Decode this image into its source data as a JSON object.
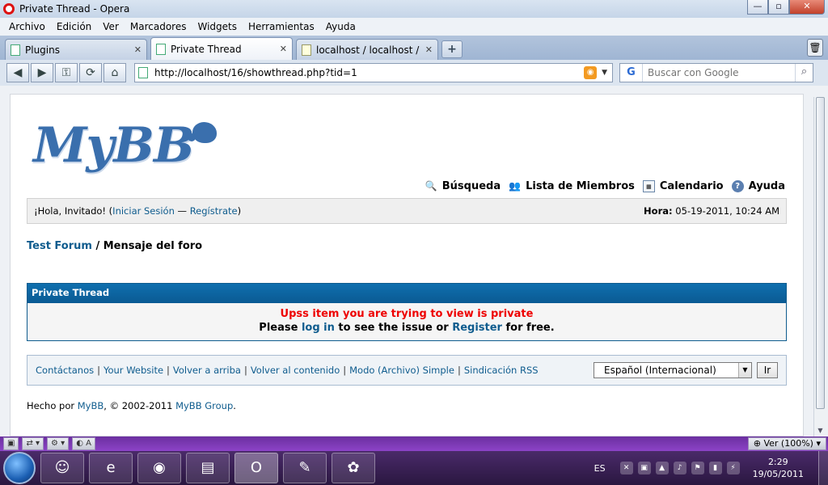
{
  "window": {
    "title": "Private Thread - Opera",
    "minimize": "—",
    "maximize": "▫",
    "close": "✕"
  },
  "menu": [
    "Archivo",
    "Edición",
    "Ver",
    "Marcadores",
    "Widgets",
    "Herramientas",
    "Ayuda"
  ],
  "tabs": [
    {
      "label": "Plugins",
      "close": "✕"
    },
    {
      "label": "Private Thread",
      "close": "✕"
    },
    {
      "label": "localhost / localhost / ...",
      "close": "✕"
    }
  ],
  "new_tab": "+",
  "address": {
    "url": "http://localhost/16/showthread.php?tid=1"
  },
  "search": {
    "placeholder": "Buscar con Google",
    "engine_icon": "G"
  },
  "page": {
    "logo_text": "MyBB",
    "top_links": [
      "Búsqueda",
      "Lista de Miembros",
      "Calendario",
      "Ayuda"
    ],
    "welcome": {
      "greeting": "¡Hola, Invitado! (",
      "login": "Iniciar Sesión",
      "dash": " — ",
      "register": "Regístrate",
      "close_paren": ")",
      "time_label": "Hora:",
      "time_value": " 05-19-2011, 10:24 AM"
    },
    "breadcrumb": {
      "forum": "Test Forum",
      "sep": " / ",
      "current": "Mensaje del foro"
    },
    "notice": {
      "header": "Private Thread",
      "error": "Upss item you are trying to view is private",
      "before_login": "Please ",
      "login": "log in",
      "middle": " to see the issue or ",
      "register": "Register",
      "after": " for free."
    },
    "footer": {
      "links": [
        "Contáctanos",
        "Your Website",
        "Volver a arriba",
        "Volver al contenido",
        "Modo (Archivo) Simple",
        "Sindicación RSS"
      ],
      "language": "Español (Internacional)",
      "go": "Ir"
    },
    "copyright": {
      "prefix": "Hecho por ",
      "mybb": "MyBB",
      "middle": ", © 2002-2011 ",
      "group": "MyBB Group",
      "suffix": "."
    }
  },
  "statusbar": {
    "zoom": "Ver (100%)"
  },
  "taskbar": {
    "lang": "ES",
    "time": "2:29",
    "date": "19/05/2011"
  }
}
